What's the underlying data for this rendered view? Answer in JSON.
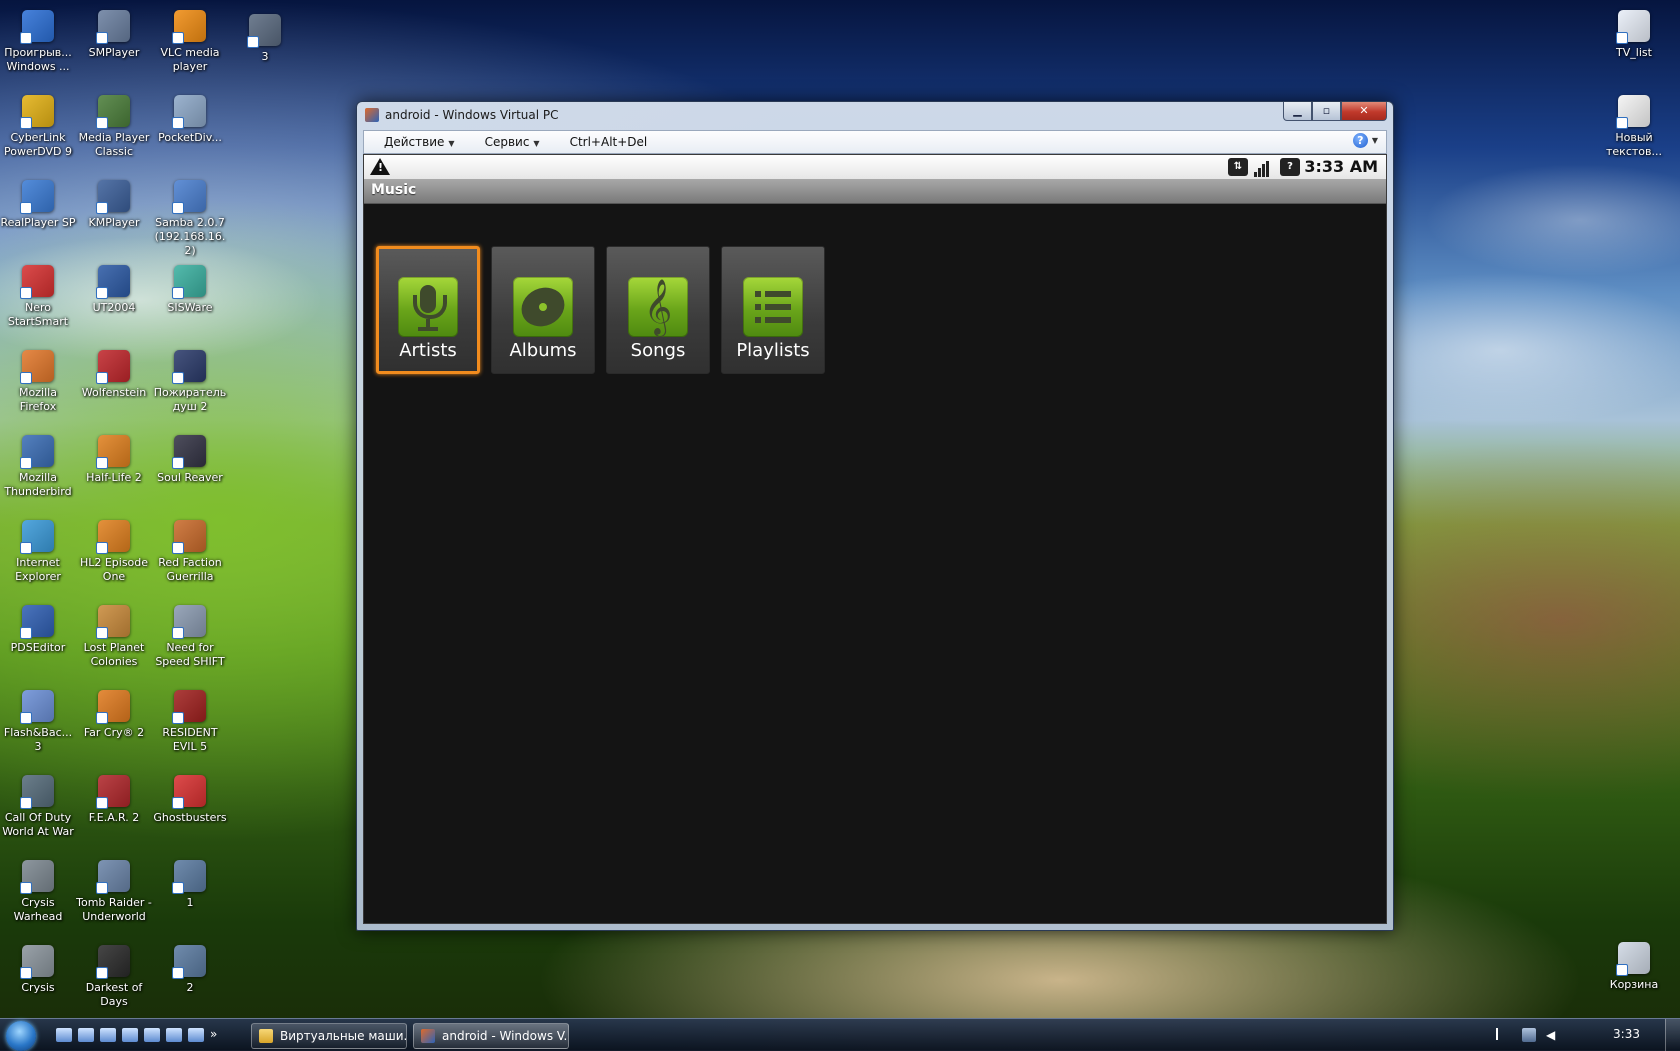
{
  "desktop": {
    "icons_col1": [
      {
        "label": "Проигрыв... Windows ...",
        "icon": "media-player-icon",
        "color": "#2b6fd6"
      },
      {
        "label": "CyberLink PowerDVD 9",
        "icon": "powerdvd-icon",
        "color": "#e3b114"
      },
      {
        "label": "RealPlayer SP",
        "icon": "realplayer-icon",
        "color": "#3a7bd5"
      },
      {
        "label": "Nero StartSmart",
        "icon": "nero-icon",
        "color": "#d63030"
      },
      {
        "label": "Mozilla Firefox",
        "icon": "firefox-icon",
        "color": "#e2772a"
      },
      {
        "label": "Mozilla Thunderbird",
        "icon": "thunderbird-icon",
        "color": "#3a6db5"
      },
      {
        "label": "Internet Explorer",
        "icon": "ie-icon",
        "color": "#3a9ad9"
      },
      {
        "label": "PDSEditor",
        "icon": "pdseditor-icon",
        "color": "#2f5fb3"
      },
      {
        "label": "Flash&Bac... 3",
        "icon": "flashback-icon",
        "color": "#6b8fd6"
      },
      {
        "label": "Call Of Duty World At War",
        "icon": "cod-icon",
        "color": "#556b7a"
      },
      {
        "label": "Crysis Warhead",
        "icon": "crysis-warhead-icon",
        "color": "#7c8790"
      },
      {
        "label": "Crysis",
        "icon": "crysis-icon",
        "color": "#8a949c"
      }
    ],
    "icons_col2": [
      {
        "label": "SMPlayer",
        "icon": "smplayer-icon",
        "color": "#6a7fa0"
      },
      {
        "label": "Media Player Classic",
        "icon": "mpc-icon",
        "color": "#4b7e3a"
      },
      {
        "label": "KMPlayer",
        "icon": "kmplayer-icon",
        "color": "#3b5f9a"
      },
      {
        "label": "UT2004",
        "icon": "ut2004-icon",
        "color": "#2c5aa5"
      },
      {
        "label": "Wolfenstein",
        "icon": "wolfenstein-icon",
        "color": "#c0262b"
      },
      {
        "label": "Half-Life 2",
        "icon": "halflife2-icon",
        "color": "#e0801e"
      },
      {
        "label": "HL2 Episode One",
        "icon": "hl2-episode-icon",
        "color": "#e0801e"
      },
      {
        "label": "Lost Planet Colonies",
        "icon": "lost-planet-icon",
        "color": "#c98a3a"
      },
      {
        "label": "Far Cry® 2",
        "icon": "farcry2-icon",
        "color": "#e07a1e"
      },
      {
        "label": "F.E.A.R. 2",
        "icon": "fear2-icon",
        "color": "#b0262a"
      },
      {
        "label": "Tomb Raider - Underworld",
        "icon": "tomb-raider-icon",
        "color": "#6a84a8"
      },
      {
        "label": "Darkest of Days",
        "icon": "darkest-of-days-icon",
        "color": "#2a2a2a"
      }
    ],
    "icons_col3": [
      {
        "label": "VLC media player",
        "icon": "vlc-icon",
        "color": "#f08c12"
      },
      {
        "label": "PocketDiv...",
        "icon": "pocketdiv-icon",
        "color": "#8da8c8"
      },
      {
        "label": "Samba 2.0.7 (192.168.16.2)",
        "icon": "samba-icon",
        "color": "#4a7fd0"
      },
      {
        "label": "SISWare",
        "icon": "sisware-icon",
        "color": "#3ab0a0"
      },
      {
        "label": "Пожиратель душ 2",
        "icon": "soul-reaver2-icon",
        "color": "#2a3a6a"
      },
      {
        "label": "Soul Reaver",
        "icon": "soul-reaver-icon",
        "color": "#333344"
      },
      {
        "label": "Red Faction Guerrilla",
        "icon": "red-faction-icon",
        "color": "#c96a2a"
      },
      {
        "label": "Need for Speed SHIFT",
        "icon": "nfs-shift-icon",
        "color": "#8a9ab0"
      },
      {
        "label": "RESIDENT EVIL 5",
        "icon": "resident-evil5-icon",
        "color": "#a0201e"
      },
      {
        "label": "Ghostbusters",
        "icon": "ghostbusters-icon",
        "color": "#d83030"
      },
      {
        "label": "1",
        "icon": "vm-shortcut-icon",
        "color": "#5a7aa0"
      },
      {
        "label": "2",
        "icon": "vm-shortcut-icon",
        "color": "#5a7aa0"
      }
    ],
    "icon_col4": {
      "label": "3",
      "icon": "vm-shortcut-icon",
      "color": "#5a6a80"
    },
    "right_icons": [
      {
        "label": "TV_list",
        "icon": "document-icon",
        "color": "#e8eef8"
      },
      {
        "label": "Новый текстов...",
        "icon": "text-file-icon",
        "color": "#f4f4f4"
      },
      {
        "label": "Корзина",
        "icon": "recycle-bin-icon",
        "color": "#cfd8e4"
      }
    ]
  },
  "window": {
    "title": "android - Windows Virtual PC",
    "menu": [
      {
        "label": "Действие",
        "has_arrow": true
      },
      {
        "label": "Сервис",
        "has_arrow": true
      },
      {
        "label": "Ctrl+Alt+Del",
        "has_arrow": false
      }
    ],
    "help_symbol": "?"
  },
  "android": {
    "status": {
      "time": "3:33 AM"
    },
    "app_title": "Music",
    "tiles": [
      {
        "label": "Artists",
        "icon": "microphone-icon",
        "focused": true
      },
      {
        "label": "Albums",
        "icon": "album-disc-icon",
        "focused": false
      },
      {
        "label": "Songs",
        "icon": "treble-clef-icon",
        "focused": false
      },
      {
        "label": "Playlists",
        "icon": "playlist-icon",
        "focused": false
      }
    ],
    "colors": {
      "focus": "#f28c1e",
      "badge": "#8cc22a",
      "background": "#141414"
    }
  },
  "taskbar": {
    "buttons": [
      {
        "label": "Виртуальные маши...",
        "icon": "folder-icon",
        "active": false
      },
      {
        "label": "android - Windows V...",
        "icon": "virtual-pc-icon",
        "active": true
      }
    ],
    "clock": "3:33"
  }
}
